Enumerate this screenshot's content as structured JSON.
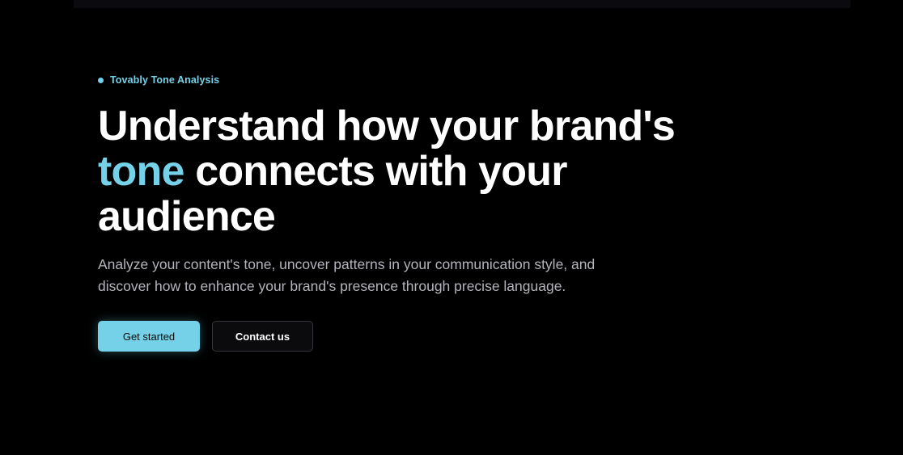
{
  "hero": {
    "eyebrow": "Tovably Tone Analysis",
    "headline_line1": "Understand how your brand's",
    "headline_accent": "tone",
    "headline_line2_rest": " connects with your",
    "headline_line3": "audience",
    "subtitle": "Analyze your content's tone, uncover patterns in your communication style, and discover how to enhance your brand's presence through precise language."
  },
  "actions": {
    "primary_label": "Get started",
    "secondary_label": "Contact us"
  },
  "colors": {
    "accent": "#75d1e8",
    "background": "#000000",
    "text": "#ffffff",
    "muted_text": "#b4b4bc"
  }
}
